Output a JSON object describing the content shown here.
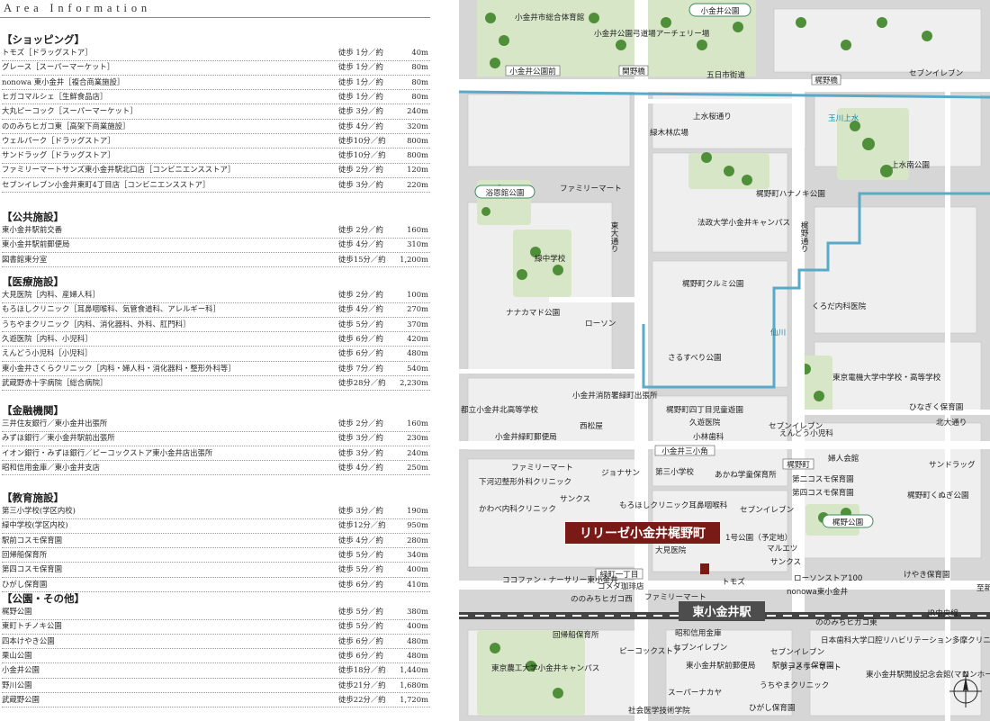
{
  "heading": "Area Information",
  "sections": [
    {
      "title": "【ショッピング】",
      "items": [
        {
          "name": "トモズ［ドラッグストア］",
          "walk": "徒歩 1分／約",
          "dist": "40m"
        },
        {
          "name": "グレース［スーパーマーケット］",
          "walk": "徒歩 1分／約",
          "dist": "80m"
        },
        {
          "name": "nonowa 東小金井［複合商業施設］",
          "walk": "徒歩 1分／約",
          "dist": "80m"
        },
        {
          "name": "ヒガコマルシェ［生鮮食品店］",
          "walk": "徒歩 1分／約",
          "dist": "80m"
        },
        {
          "name": "大丸ピーコック［スーパーマーケット］",
          "walk": "徒歩 3分／約",
          "dist": "240m"
        },
        {
          "name": "ののみちヒガコ東［高架下商業施設］",
          "walk": "徒歩 4分／約",
          "dist": "320m"
        },
        {
          "name": "ウェルパーク［ドラッグストア］",
          "walk": "徒歩10分／約",
          "dist": "800m"
        },
        {
          "name": "サンドラッグ［ドラッグストア］",
          "walk": "徒歩10分／約",
          "dist": "800m"
        },
        {
          "name": "ファミリーマートサンズ東小金井駅北口店［コンビニエンスストア］",
          "walk": "徒歩 2分／約",
          "dist": "120m"
        },
        {
          "name": "セブンイレブン小金井東町4丁目店［コンビニエンスストア］",
          "walk": "徒歩 3分／約",
          "dist": "220m"
        }
      ]
    },
    {
      "title": "【公共施設】",
      "items": [
        {
          "name": "東小金井駅前交番",
          "walk": "徒歩 2分／約",
          "dist": "160m"
        },
        {
          "name": "東小金井駅前郵便局",
          "walk": "徒歩 4分／約",
          "dist": "310m"
        },
        {
          "name": "図書館東分室",
          "walk": "徒歩15分／約",
          "dist": "1,200m"
        }
      ]
    },
    {
      "title": "【医療施設】",
      "items": [
        {
          "name": "大見医院［内科、産婦人科］",
          "walk": "徒歩 2分／約",
          "dist": "100m"
        },
        {
          "name": "もろほしクリニック［耳鼻咽喉科、気管食道科、アレルギー科］",
          "walk": "徒歩 4分／約",
          "dist": "270m"
        },
        {
          "name": "うちやまクリニック［内科、消化器科、外科、肛門科］",
          "walk": "徒歩 5分／約",
          "dist": "370m"
        },
        {
          "name": "久遊医院［内科、小児科］",
          "walk": "徒歩 6分／約",
          "dist": "420m"
        },
        {
          "name": "えんどう小児科［小児科］",
          "walk": "徒歩 6分／約",
          "dist": "480m"
        },
        {
          "name": "東小金井さくらクリニック［内科・婦人科・消化器科・整形外科等］",
          "walk": "徒歩 7分／約",
          "dist": "540m"
        },
        {
          "name": "武蔵野赤十字病院［総合病院］",
          "walk": "徒歩28分／約",
          "dist": "2,230m"
        }
      ]
    },
    {
      "title": "【金融機関】",
      "items": [
        {
          "name": "三井住友銀行／東小金井出張所",
          "walk": "徒歩 2分／約",
          "dist": "160m"
        },
        {
          "name": "みずほ銀行／東小金井駅前出張所",
          "walk": "徒歩 3分／約",
          "dist": "230m"
        },
        {
          "name": "イオン銀行・みずほ銀行／ピーコックストア東小金井店出張所",
          "walk": "徒歩 3分／約",
          "dist": "240m"
        },
        {
          "name": "昭和信用金庫／東小金井支店",
          "walk": "徒歩 4分／約",
          "dist": "250m"
        }
      ]
    },
    {
      "title": "【教育施設】",
      "items": [
        {
          "name": "第三小学校(学区内校)",
          "walk": "徒歩 3分／約",
          "dist": "190m"
        },
        {
          "name": "緑中学校(学区内校)",
          "walk": "徒歩12分／約",
          "dist": "950m"
        },
        {
          "name": "駅前コスモ保育園",
          "walk": "徒歩 4分／約",
          "dist": "280m"
        },
        {
          "name": "回帰船保育所",
          "walk": "徒歩 5分／約",
          "dist": "340m"
        },
        {
          "name": "第四コスモ保育園",
          "walk": "徒歩 5分／約",
          "dist": "400m"
        },
        {
          "name": "ひがし保育園",
          "walk": "徒歩 6分／約",
          "dist": "410m"
        }
      ]
    },
    {
      "title": "【公園・その他】",
      "items": [
        {
          "name": "梶野公園",
          "walk": "徒歩 5分／約",
          "dist": "380m"
        },
        {
          "name": "東町トチノキ公園",
          "walk": "徒歩 5分／約",
          "dist": "400m"
        },
        {
          "name": "四本けやき公園",
          "walk": "徒歩 6分／約",
          "dist": "480m"
        },
        {
          "name": "栗山公園",
          "walk": "徒歩 6分／約",
          "dist": "480m"
        },
        {
          "name": "小金井公園",
          "walk": "徒歩18分／約",
          "dist": "1,440m"
        },
        {
          "name": "野川公園",
          "walk": "徒歩21分／約",
          "dist": "1,680m"
        },
        {
          "name": "武蔵野公園",
          "walk": "徒歩22分／約",
          "dist": "1,720m"
        }
      ]
    }
  ],
  "map": {
    "property_name": "リリーゼ小金井梶野町",
    "station_name": "東小金井駅",
    "line_name": "JR中央線",
    "to_shinjuku": "至新宿",
    "compass": "N",
    "colors": {
      "property": "#7a1a16",
      "station": "#4d4d4d",
      "water": "#1a86a6",
      "park": "#d7e6c6",
      "road": "#e9e9e9"
    },
    "parks": [
      "小金井公園",
      "浴恩館公園",
      "梶野公園"
    ],
    "water_labels": [
      "玉川上水",
      "仙川"
    ],
    "signals": [
      "小金井公園前",
      "関野橋",
      "梶野橋",
      "小金井三小角",
      "梶野町",
      "緑町一丁目"
    ],
    "roads": [
      "五日市街道",
      "東大通り",
      "梶野通り",
      "北大通り",
      "上水桜通り"
    ],
    "places": [
      "小金井市総合体育館",
      "小金井公園弓道場アーチェリー場",
      "セブンイレブン",
      "緑木林広場",
      "上水南公園",
      "ファミリーマート",
      "梶野町ハナノキ公園",
      "法政大学小金井キャンパス",
      "緑中学校",
      "梶野町クルミ公園",
      "ナナカマド公園",
      "ローソン",
      "くろだ内科医院",
      "さるすべり公園",
      "東京電機大学中学校・高等学校",
      "都立小金井北高等学校",
      "小金井消防署緑町出張所",
      "梶野町四丁目児童遊園",
      "ひなぎく保育園",
      "西松屋",
      "久遊医院",
      "小林歯科",
      "セブンイレブン",
      "小金井緑町郵便局",
      "えんどう小児科",
      "ファミリーマート",
      "ジョナサン",
      "第三小学校",
      "あかね学童保育所",
      "婦人会館",
      "第二コスモ保育園",
      "第四コスモ保育園",
      "サンドラッグ",
      "下河辺整形外科クリニック",
      "サンクス",
      "かわべ内科クリニック",
      "もろほしクリニック耳鼻咽喉科",
      "セブンイレブン",
      "梶野町くぬぎ公園",
      "1号公園（予定地）",
      "マルエツ",
      "サンクス",
      "大見医院",
      "ローソンストア100",
      "けやき保育園",
      "ココファン・ナーサリー東小金井",
      "コメダ珈琲店",
      "ののみちヒガコ西",
      "トモズ",
      "nonowa東小金井",
      "ファミリーマート",
      "ののみちヒガコ東",
      "回帰船保育所",
      "昭和信用金庫",
      "日本歯科大学口腔リハビリテーション多摩クリニック",
      "ピーコックストア",
      "セブンイレブン",
      "セブンイレブン",
      "東京農工大学小金井キャンパス",
      "東小金井駅前郵便局",
      "駅前コスモ保育園",
      "ファミリーマート",
      "東小金井駅開設記念会館(マロンホール)",
      "スーパーナカヤ",
      "うちやまクリニック",
      "社会医学技術学院",
      "ひがし保育園"
    ]
  }
}
